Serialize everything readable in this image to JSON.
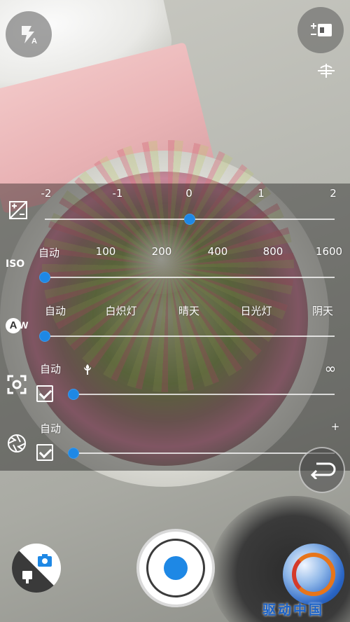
{
  "exposure": {
    "ticks": [
      "-2",
      "-1",
      "0",
      "1",
      "2"
    ],
    "min": -2,
    "max": 2,
    "value": 0
  },
  "iso": {
    "label": "ISO",
    "ticks": [
      "自动",
      "100",
      "200",
      "400",
      "800",
      "1600"
    ],
    "selected_index": 0
  },
  "white_balance": {
    "icon_letter": "A",
    "icon_letter2": "W",
    "ticks": [
      "自动",
      "白炽灯",
      "晴天",
      "日光灯",
      "阴天"
    ],
    "selected_index": 0
  },
  "focus": {
    "auto_label": "自动",
    "far_label": "∞",
    "auto_checked": true,
    "value": 0.1
  },
  "shutter_speed": {
    "auto_label": "自动",
    "end_label": "+",
    "auto_checked": true,
    "value": 0.1
  },
  "icons": {
    "flash": "flash-auto-icon",
    "settings": "settings-icon",
    "level": "level-icon",
    "back": "back-icon"
  },
  "watermark": {
    "text": "驱动中国"
  },
  "colors": {
    "accent": "#1e88e5"
  }
}
